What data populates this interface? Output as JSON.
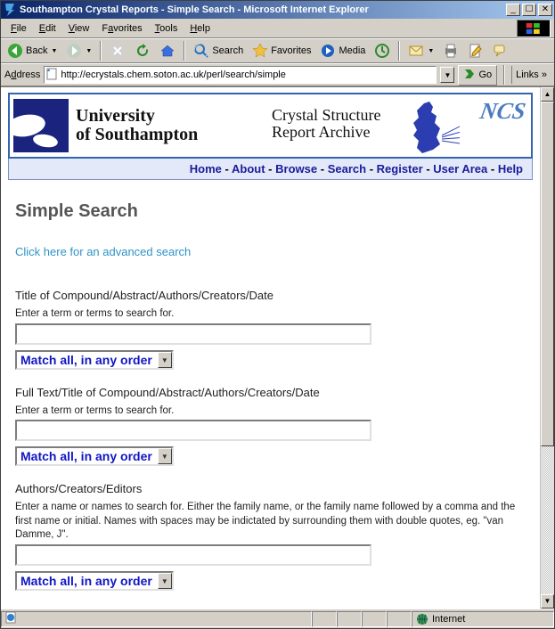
{
  "window": {
    "title": "Southampton Crystal Reports - Simple Search - Microsoft Internet Explorer"
  },
  "menu": {
    "file": "File",
    "edit": "Edit",
    "view": "View",
    "favorites": "Favorites",
    "tools": "Tools",
    "help": "Help"
  },
  "toolbar": {
    "back": "Back",
    "search": "Search",
    "favorites": "Favorites",
    "media": "Media"
  },
  "address": {
    "label": "Address",
    "url": "http://ecrystals.chem.soton.ac.uk/perl/search/simple",
    "go": "Go",
    "links": "Links"
  },
  "banner": {
    "uni_line1": "University",
    "uni_line2": "of Southampton",
    "csr_line1": "Crystal Structure",
    "csr_line2": "Report Archive",
    "ncs": "NCS"
  },
  "nav": {
    "home": "Home",
    "about": "About",
    "browse": "Browse",
    "search": "Search",
    "register": "Register",
    "userarea": "User Area",
    "help": "Help",
    "sep": "-"
  },
  "page": {
    "heading": "Simple Search",
    "adv_link": "Click here for an advanced search",
    "fields": [
      {
        "label": "Title of Compound/Abstract/Authors/Creators/Date",
        "hint": "Enter a term or terms to search for.",
        "value": "",
        "match": "Match all, in any order"
      },
      {
        "label": "Full Text/Title of Compound/Abstract/Authors/Creators/Date",
        "hint": "Enter a term or terms to search for.",
        "value": "",
        "match": "Match all, in any order"
      },
      {
        "label": "Authors/Creators/Editors",
        "hint": "Enter a name or names to search for. Either the family name, or the family name followed by a comma and the first name or initial. Names with spaces may be indictated by surrounding them with double quotes, eg. \"van Damme, J\".",
        "value": "",
        "match": "Match all, in any order"
      }
    ]
  },
  "status": {
    "zone": "Internet"
  },
  "glyphs": {
    "minimize": "0",
    "maximize": "1",
    "close": "r",
    "dropdown": "▼",
    "up": "▲",
    "down": "▼",
    "chev_right": "»",
    "back_arrow": "⬅",
    "fwd_arrow": "➡"
  },
  "colors": {
    "titlebar_start": "#082468",
    "titlebar_end": "#a6caf0",
    "link_blue": "#1b1b9a",
    "select_blue": "#1016c4",
    "banner_border": "#3264af"
  }
}
